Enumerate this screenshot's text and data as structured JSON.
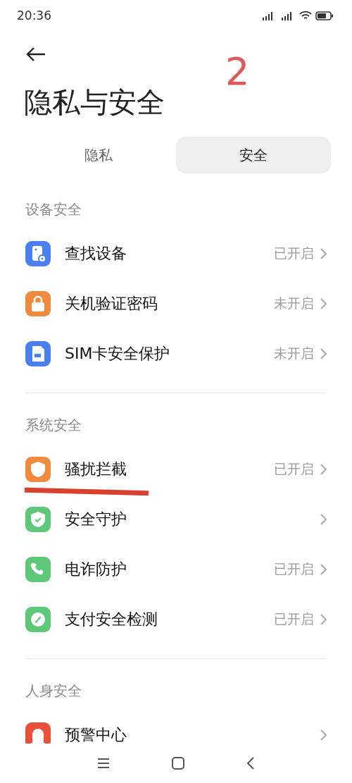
{
  "status_bar": {
    "time": "20:36"
  },
  "header": {
    "title": "隐私与安全"
  },
  "tabs": [
    {
      "label": "隐私",
      "selected": false
    },
    {
      "label": "安全",
      "selected": true
    }
  ],
  "sections": [
    {
      "title": "设备安全",
      "items": [
        {
          "label": "查找设备",
          "status": "已开启"
        },
        {
          "label": "关机验证密码",
          "status": "未开启"
        },
        {
          "label": "SIM卡安全保护",
          "status": "未开启"
        }
      ]
    },
    {
      "title": "系统安全",
      "items": [
        {
          "label": "骚扰拦截",
          "status": "已开启"
        },
        {
          "label": "安全守护"
        },
        {
          "label": "电诈防护",
          "status": "已开启"
        },
        {
          "label": "支付安全检测",
          "status": "已开启"
        }
      ]
    },
    {
      "title": "人身安全",
      "items": [
        {
          "label": "预警中心"
        }
      ]
    }
  ],
  "annotations": [
    {
      "kind": "number",
      "text": "2"
    },
    {
      "kind": "underline"
    }
  ]
}
